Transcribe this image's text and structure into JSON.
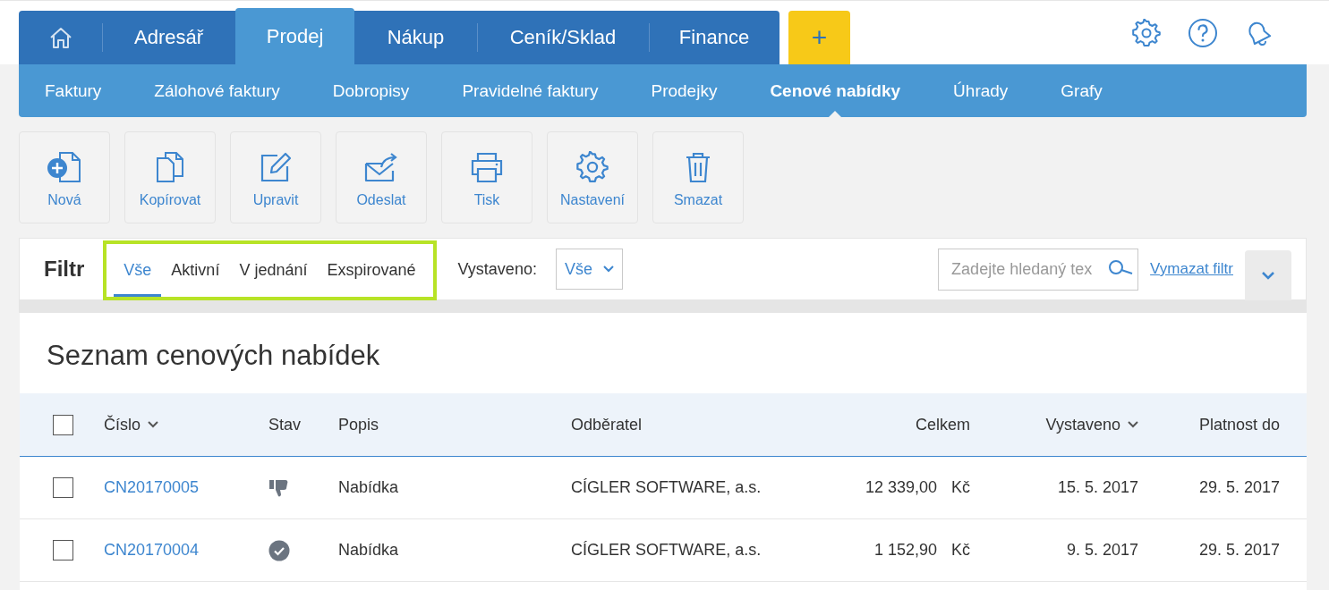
{
  "main_tabs": [
    {
      "kind": "home",
      "selected": false
    },
    {
      "kind": "text",
      "label": "Adresář",
      "selected": false
    },
    {
      "kind": "text",
      "label": "Prodej",
      "selected": true
    },
    {
      "kind": "text",
      "label": "Nákup",
      "selected": false
    },
    {
      "kind": "text",
      "label": "Ceník/Sklad",
      "selected": false
    },
    {
      "kind": "text",
      "label": "Finance",
      "selected": false
    }
  ],
  "add_button": {
    "label": "+"
  },
  "header_icons": [
    {
      "kind": "settings"
    },
    {
      "kind": "help"
    },
    {
      "kind": "bell"
    }
  ],
  "sub_tabs": [
    {
      "label": "Faktury",
      "selected": false
    },
    {
      "label": "Zálohové faktury",
      "selected": false
    },
    {
      "label": "Dobropisy",
      "selected": false
    },
    {
      "label": "Pravidelné faktury",
      "selected": false
    },
    {
      "label": "Prodejky",
      "selected": false
    },
    {
      "label": "Cenové nabídky",
      "selected": true
    },
    {
      "label": "Úhrady",
      "selected": false
    },
    {
      "label": "Grafy",
      "selected": false
    }
  ],
  "toolbar": [
    {
      "kind": "new",
      "label": "Nová"
    },
    {
      "kind": "copy",
      "label": "Kopírovat"
    },
    {
      "kind": "edit",
      "label": "Upravit"
    },
    {
      "kind": "send",
      "label": "Odeslat"
    },
    {
      "kind": "print",
      "label": "Tisk"
    },
    {
      "kind": "settings",
      "label": "Nastavení"
    },
    {
      "kind": "delete",
      "label": "Smazat"
    }
  ],
  "filter": {
    "title": "Filtr",
    "tabs": [
      {
        "label": "Vše",
        "selected": true
      },
      {
        "label": "Aktivní",
        "selected": false
      },
      {
        "label": "V jednání",
        "selected": false
      },
      {
        "label": "Exspirované",
        "selected": false
      }
    ],
    "issued_label": "Vystaveno:",
    "issued_value": "Vše",
    "search": {
      "placeholder": "Zadejte hledaný tex"
    },
    "clear_link": "Vymazat filtr"
  },
  "list": {
    "title": "Seznam cenových nabídek",
    "select_all": {
      "checked": false
    },
    "columns": [
      {
        "label": "Číslo",
        "sortable": true
      },
      {
        "label": "Stav",
        "sortable": false
      },
      {
        "label": "Popis",
        "sortable": false
      },
      {
        "label": "Odběratel",
        "sortable": false
      },
      {
        "label": "Celkem",
        "sortable": false
      },
      {
        "label": "Vystaveno",
        "sortable": true
      },
      {
        "label": "Platnost do",
        "sortable": false
      }
    ],
    "rows": [
      {
        "checked": false,
        "number": "CN20170005",
        "kind": "rejected",
        "description": "Nabídka",
        "customer": "CÍGLER SOFTWARE, a.s.",
        "amount": "12 339,00",
        "currency": "Kč",
        "issued": "15. 5. 2017",
        "valid_until": "29. 5. 2017"
      },
      {
        "checked": false,
        "number": "CN20170004",
        "kind": "accepted",
        "description": "Nabídka",
        "customer": "CÍGLER SOFTWARE, a.s.",
        "amount": "1 152,90",
        "currency": "Kč",
        "issued": "9. 5. 2017",
        "valid_until": "29. 5. 2017"
      }
    ]
  }
}
